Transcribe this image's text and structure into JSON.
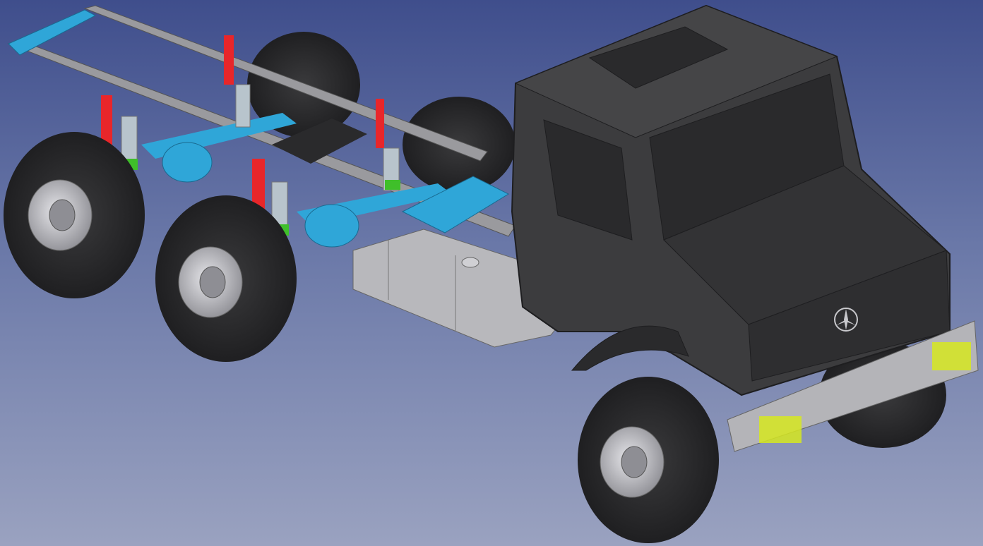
{
  "viewport": {
    "background_top": "#3f4e8c",
    "background_bottom": "#9aa2c0"
  },
  "colors": {
    "cab": "#3c3c3e",
    "cab_dark": "#2a2a2c",
    "tire": "#2f2f31",
    "rim": "#c8c8cc",
    "frame_rail": "#9a9a9e",
    "axle": "#2fa6d8",
    "shock": "#e8262a",
    "spring": "#b8c4cc",
    "spring_mount": "#3fbf2a",
    "fuel_tank": "#b8b8bc",
    "bumper": "#b4b4b8",
    "highlight": "#d6e820"
  },
  "icons": [
    "mercedes-star-icon"
  ]
}
